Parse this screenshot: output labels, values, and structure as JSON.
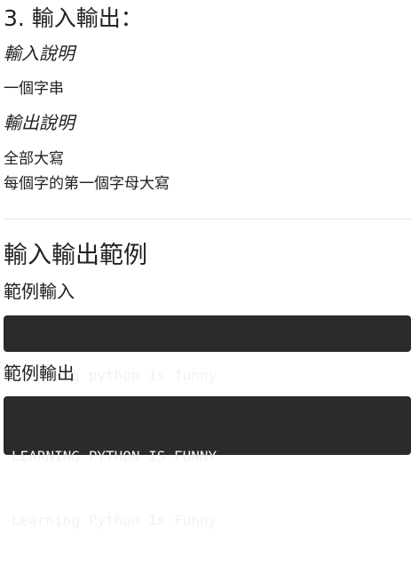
{
  "section_title": "3. 輸入輸出：",
  "input_desc_heading": "輸入說明",
  "input_desc_text": "一個字串",
  "output_desc_heading": "輸出說明",
  "output_desc_lines": [
    "全部大寫",
    "每個字的第一個字母大寫"
  ],
  "examples_heading": "輸入輸出範例",
  "sample_input_heading": "範例輸入",
  "sample_input_code": [
    "learning python is funny"
  ],
  "sample_output_heading": "範例輸出",
  "sample_output_code": [
    "LEARNING PYTHON IS FUNNY",
    "Learning Python Is Funny"
  ],
  "colors": {
    "text": "#212121",
    "code_background": "#2b2b2b",
    "code_text": "#f2f2f2",
    "divider": "#e8e8e8"
  }
}
